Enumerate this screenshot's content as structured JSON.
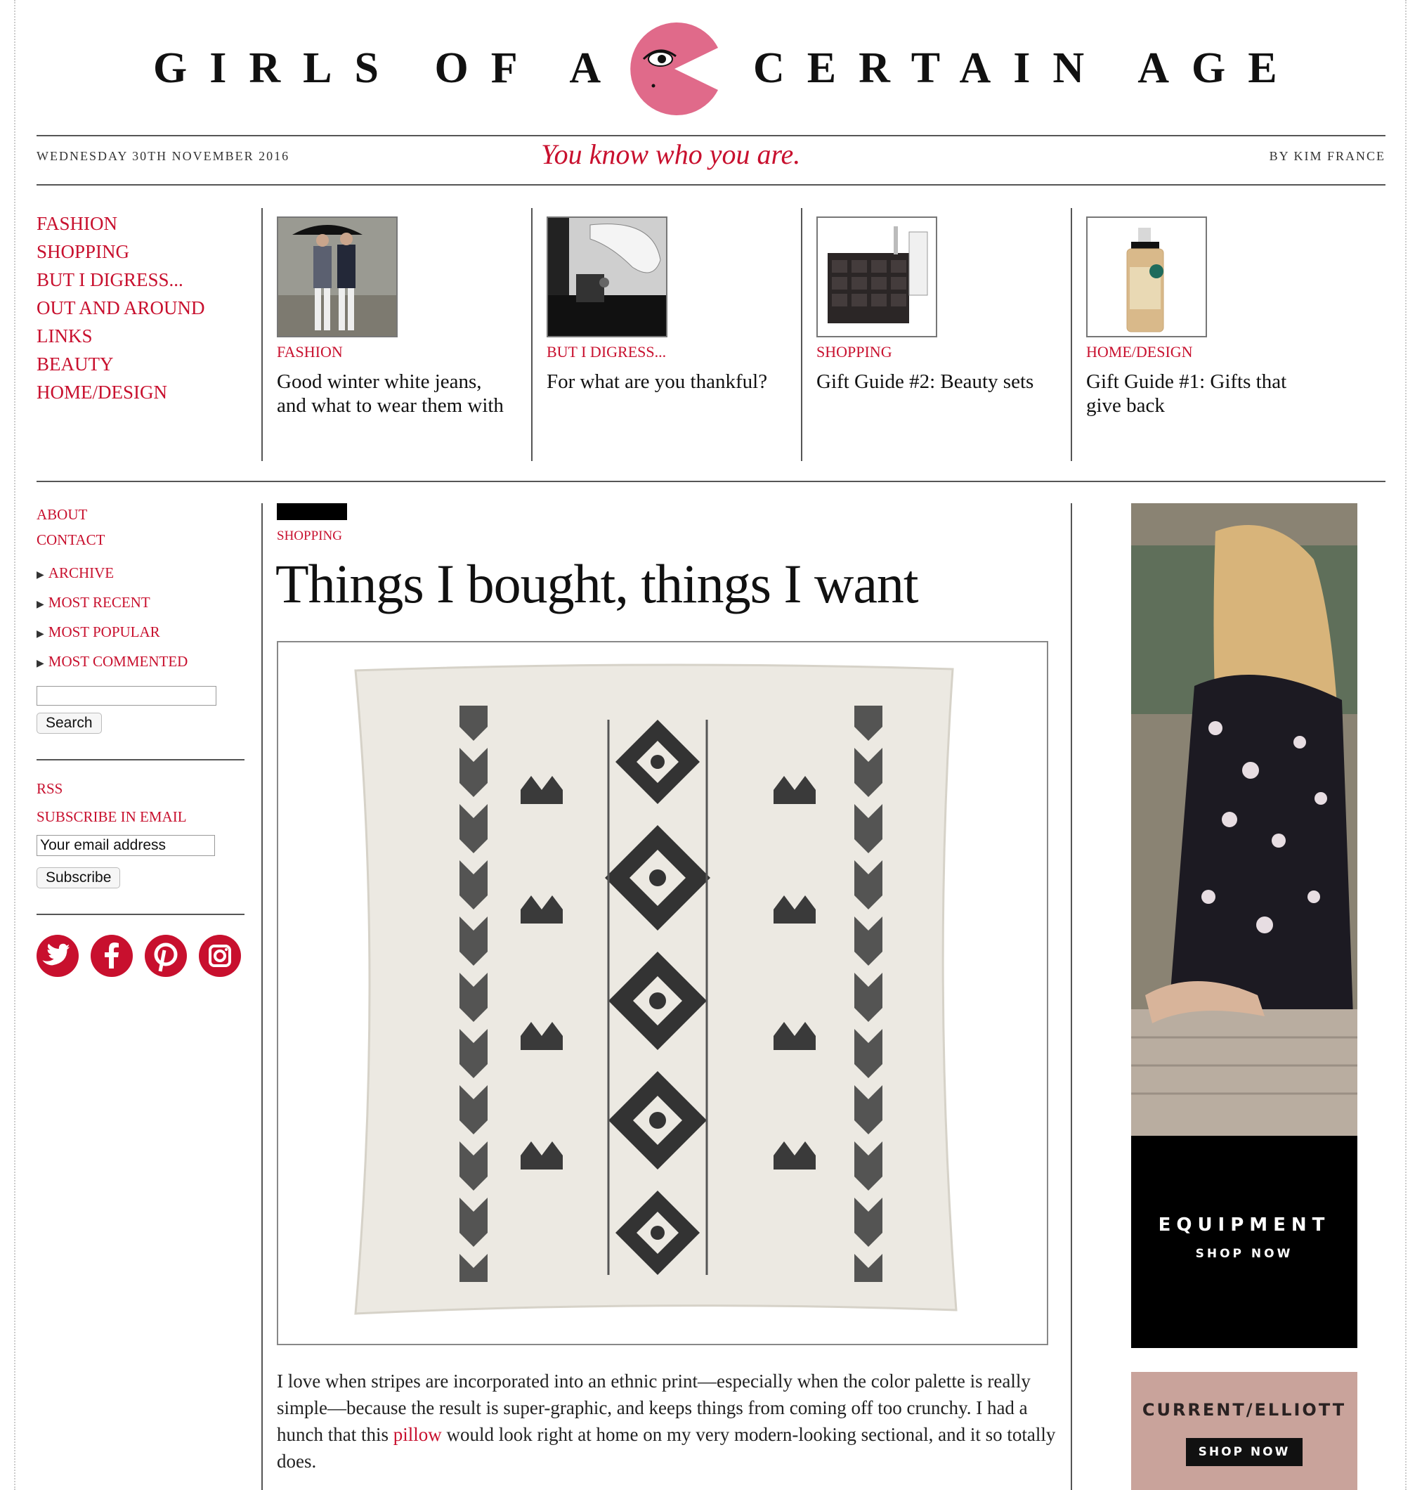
{
  "masthead": {
    "left_text": "GIRLS OF A",
    "right_text": "CERTAIN AGE",
    "logo_icon": "pink-pacman-eye-logo"
  },
  "dateline": "WEDNESDAY 30TH NOVEMBER 2016",
  "tagline": "You know who you are.",
  "byline": "BY KIM FRANCE",
  "topnav": [
    "FASHION",
    "SHOPPING",
    "BUT I DIGRESS...",
    "OUT AND AROUND",
    "LINKS",
    "BEAUTY",
    "HOME/DESIGN"
  ],
  "features": [
    {
      "category": "FASHION",
      "title": "Good winter white jeans, and what to wear them with"
    },
    {
      "category": "BUT I DIGRESS...",
      "title": "For what are you thankful?"
    },
    {
      "category": "SHOPPING",
      "title": "Gift Guide #2: Beauty sets"
    },
    {
      "category": "HOME/DESIGN",
      "title": "Gift Guide #1: Gifts that give back"
    }
  ],
  "sidebar": {
    "about": "ABOUT",
    "contact": "CONTACT",
    "arrow_links": [
      "ARCHIVE",
      "MOST RECENT",
      "MOST POPULAR",
      "MOST COMMENTED"
    ],
    "search_button": "Search",
    "rss": "RSS",
    "subscribe_label": "SUBSCRIBE IN EMAIL",
    "email_placeholder": "Your email address",
    "subscribe_button": "Subscribe",
    "social_icons": [
      "twitter-icon",
      "facebook-icon",
      "pinterest-icon",
      "instagram-icon"
    ]
  },
  "article": {
    "category": "SHOPPING",
    "title": "Things I bought, things I want",
    "image_subject": "embroidered-linen-pillow",
    "body_before_link": "I love when stripes are incorporated into an ethnic print—especially when the color palette is really simple—because the result is super-graphic, and keeps things from coming off too crunchy. I had a hunch that this ",
    "body_link": "pillow",
    "body_after_link": " would look right at home on my very modern-looking sectional, and it so totally does."
  },
  "ads": [
    {
      "brand": "EQUIPMENT",
      "cta": "SHOP NOW"
    },
    {
      "brand": "CURRENT/ELLIOTT",
      "cta": "SHOP NOW"
    }
  ],
  "colors": {
    "accent": "#c8102e",
    "logo_pink": "#e06a8a",
    "rule": "#555555"
  }
}
